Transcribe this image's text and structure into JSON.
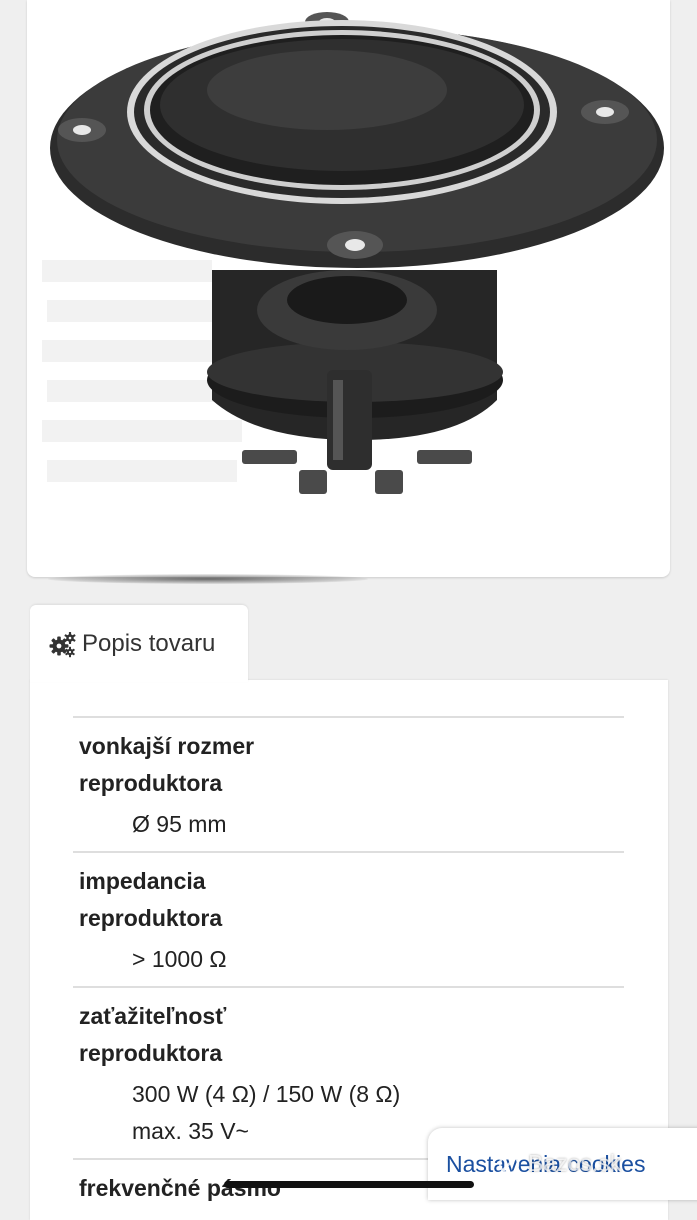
{
  "tab": {
    "label": "Popis tovaru",
    "icon": "gears-icon"
  },
  "specs": [
    {
      "label": "vonkajší rozmer reproduktora",
      "value": "Ø 95 mm"
    },
    {
      "label": "impedancia reproduktora",
      "value": "> 1000 Ω"
    },
    {
      "label": "zaťažiteľnosť reproduktora",
      "value": "300 W (4 Ω) / 150 W (8 Ω) max. 35 V~"
    },
    {
      "label": "frekvenčné pásmo",
      "value": ""
    }
  ],
  "cookies": {
    "label": "Nastavenia cookies"
  },
  "watermark": {
    "text": "Bazos.sk"
  },
  "colors": {
    "link": "#1a4fa0",
    "background": "#efefef",
    "divider": "#dedede"
  }
}
